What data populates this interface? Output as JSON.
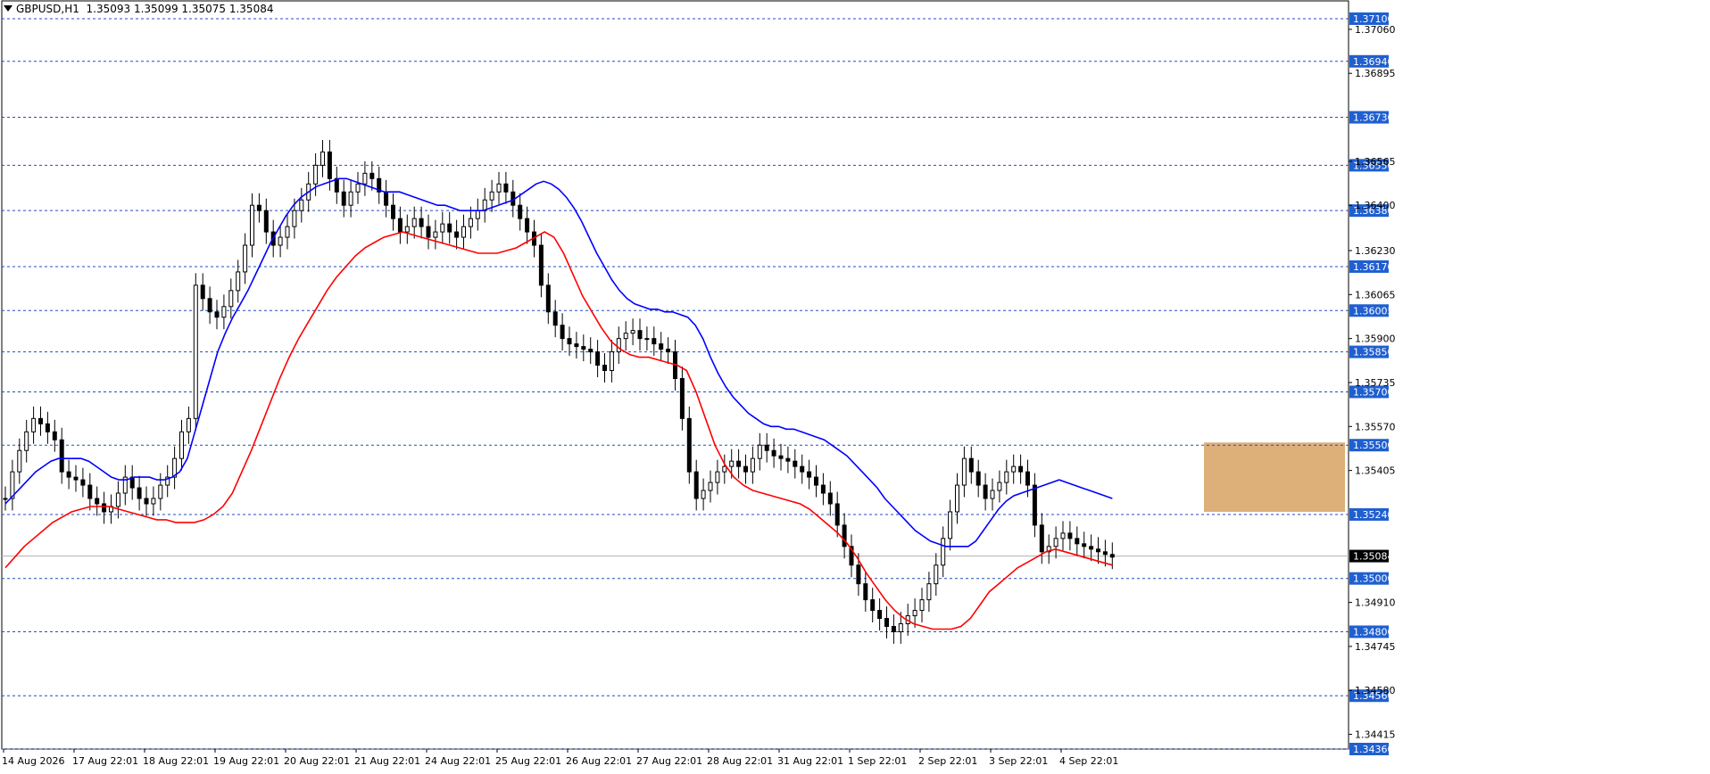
{
  "header": {
    "symbol": "GBPUSD,H1",
    "ohlc": "1.35093 1.35099 1.35075 1.35084"
  },
  "colors": {
    "ma_fast": "#0000ff",
    "ma_slow": "#ff0000",
    "level_line": "#1f4fbf",
    "level_label_bg": "#1f5fd0",
    "price_label_bg": "#000000",
    "zone": "#d9a66a",
    "candle": "#000000"
  },
  "chart_data": {
    "type": "candlestick",
    "ylim": [
      1.3436,
      1.3715
    ],
    "y_ticks": [
      "1.37060",
      "1.36895",
      "1.36565",
      "1.36400",
      "1.36230",
      "1.36065",
      "1.35900",
      "1.35735",
      "1.35570",
      "1.35405",
      "1.34910",
      "1.34745",
      "1.34580",
      "1.34415"
    ],
    "x_ticks": [
      "14 Aug 2026",
      "17 Aug 22:01",
      "18 Aug 22:01",
      "19 Aug 22:01",
      "20 Aug 22:01",
      "21 Aug 22:01",
      "24 Aug 22:01",
      "25 Aug 22:01",
      "26 Aug 22:01",
      "27 Aug 22:01",
      "28 Aug 22:01",
      "31 Aug 22:01",
      "1 Sep 22:01",
      "2 Sep 22:01",
      "3 Sep 22:01",
      "4 Sep 22:01"
    ],
    "levels": [
      "1.37100",
      "1.36940",
      "1.36730",
      "1.36550",
      "1.36380",
      "1.36170",
      "1.36005",
      "1.35850",
      "1.35700",
      "1.35500",
      "1.35240",
      "1.35000",
      "1.34800",
      "1.34560",
      "1.34360"
    ],
    "current_price": "1.35084",
    "zone": {
      "x_start": 170,
      "x_end": 190,
      "price_low": 1.3525,
      "price_high": 1.3551
    },
    "close": [
      1.353,
      1.354,
      1.3548,
      1.3555,
      1.356,
      1.3558,
      1.3555,
      1.3552,
      1.354,
      1.3538,
      1.3537,
      1.3535,
      1.353,
      1.3528,
      1.3525,
      1.3527,
      1.3532,
      1.3538,
      1.3534,
      1.353,
      1.3528,
      1.353,
      1.3535,
      1.3538,
      1.3545,
      1.3555,
      1.356,
      1.361,
      1.3605,
      1.36,
      1.3598,
      1.3602,
      1.3608,
      1.3615,
      1.3625,
      1.364,
      1.3638,
      1.363,
      1.3625,
      1.3628,
      1.3632,
      1.3638,
      1.3642,
      1.3648,
      1.3655,
      1.366,
      1.365,
      1.3645,
      1.364,
      1.3645,
      1.3648,
      1.3652,
      1.365,
      1.3645,
      1.364,
      1.3635,
      1.363,
      1.3632,
      1.3635,
      1.3632,
      1.3628,
      1.363,
      1.3633,
      1.363,
      1.3628,
      1.3632,
      1.3635,
      1.3638,
      1.3642,
      1.3645,
      1.3648,
      1.3645,
      1.364,
      1.3635,
      1.363,
      1.3625,
      1.361,
      1.36,
      1.3595,
      1.359,
      1.3588,
      1.3587,
      1.3586,
      1.3585,
      1.358,
      1.3578,
      1.3585,
      1.359,
      1.3592,
      1.3593,
      1.359,
      1.359,
      1.3588,
      1.3586,
      1.3585,
      1.3575,
      1.356,
      1.354,
      1.353,
      1.3533,
      1.3536,
      1.354,
      1.3542,
      1.3544,
      1.3542,
      1.354,
      1.3545,
      1.355,
      1.3548,
      1.3546,
      1.3545,
      1.3544,
      1.3542,
      1.354,
      1.3538,
      1.3535,
      1.3532,
      1.3528,
      1.352,
      1.3512,
      1.3505,
      1.3498,
      1.3492,
      1.3488,
      1.3485,
      1.3482,
      1.348,
      1.3483,
      1.3486,
      1.3488,
      1.3492,
      1.3498,
      1.3505,
      1.3515,
      1.3525,
      1.3535,
      1.3545,
      1.354,
      1.3535,
      1.353,
      1.3533,
      1.3536,
      1.354,
      1.3542,
      1.354,
      1.3535,
      1.352,
      1.351,
      1.3512,
      1.3515,
      1.3517,
      1.3515,
      1.3513,
      1.3512,
      1.3511,
      1.351,
      1.3509,
      1.3508
    ],
    "ma_fast": [
      1.3528,
      1.3531,
      1.3534,
      1.3537,
      1.354,
      1.3542,
      1.3544,
      1.3545,
      1.3545,
      1.3545,
      1.3545,
      1.3544,
      1.3542,
      1.354,
      1.3538,
      1.3537,
      1.3537,
      1.3538,
      1.3538,
      1.3538,
      1.3537,
      1.3537,
      1.3538,
      1.354,
      1.3545,
      1.3555,
      1.3565,
      1.3575,
      1.3585,
      1.3592,
      1.3598,
      1.3603,
      1.3608,
      1.3614,
      1.362,
      1.3626,
      1.3631,
      1.3636,
      1.364,
      1.3643,
      1.3645,
      1.3647,
      1.3648,
      1.3649,
      1.365,
      1.365,
      1.3649,
      1.3648,
      1.3647,
      1.3646,
      1.3645,
      1.3645,
      1.3645,
      1.3644,
      1.3643,
      1.3642,
      1.3641,
      1.364,
      1.364,
      1.3639,
      1.3638,
      1.3638,
      1.3638,
      1.3638,
      1.3639,
      1.364,
      1.3641,
      1.3642,
      1.3644,
      1.3646,
      1.3648,
      1.3649,
      1.3648,
      1.3646,
      1.3643,
      1.3639,
      1.3634,
      1.3628,
      1.3622,
      1.3617,
      1.3612,
      1.3608,
      1.3605,
      1.3603,
      1.3602,
      1.3601,
      1.3601,
      1.36,
      1.36,
      1.3599,
      1.3598,
      1.3595,
      1.359,
      1.3583,
      1.3577,
      1.3572,
      1.3568,
      1.3565,
      1.3562,
      1.356,
      1.3558,
      1.3557,
      1.3557,
      1.3556,
      1.3556,
      1.3555,
      1.3554,
      1.3553,
      1.3552,
      1.355,
      1.3548,
      1.3546,
      1.3543,
      1.354,
      1.3537,
      1.3534,
      1.353,
      1.3527,
      1.3524,
      1.3521,
      1.3518,
      1.3516,
      1.3514,
      1.3513,
      1.3512,
      1.3512,
      1.3512,
      1.3512,
      1.3514,
      1.3518,
      1.3522,
      1.3526,
      1.3529,
      1.3531,
      1.3532,
      1.3533,
      1.3534,
      1.3535,
      1.3536,
      1.3537,
      1.3536,
      1.3535,
      1.3534,
      1.3533,
      1.3532,
      1.3531,
      1.353
    ],
    "ma_slow": [
      1.3504,
      1.3508,
      1.3512,
      1.3515,
      1.3518,
      1.3521,
      1.3523,
      1.3525,
      1.3526,
      1.3527,
      1.3527,
      1.3527,
      1.3526,
      1.3525,
      1.3524,
      1.3523,
      1.3522,
      1.3522,
      1.3521,
      1.3521,
      1.3521,
      1.3522,
      1.3524,
      1.3527,
      1.3532,
      1.354,
      1.3548,
      1.3557,
      1.3566,
      1.3575,
      1.3583,
      1.359,
      1.3596,
      1.3602,
      1.3608,
      1.3613,
      1.3617,
      1.3621,
      1.3624,
      1.3626,
      1.3628,
      1.3629,
      1.363,
      1.3629,
      1.3628,
      1.3627,
      1.3626,
      1.3625,
      1.3624,
      1.3623,
      1.3622,
      1.3622,
      1.3622,
      1.3623,
      1.3624,
      1.3626,
      1.3628,
      1.363,
      1.3628,
      1.3622,
      1.3614,
      1.3606,
      1.36,
      1.3594,
      1.3589,
      1.3586,
      1.3584,
      1.3583,
      1.3583,
      1.3582,
      1.3581,
      1.358,
      1.3578,
      1.357,
      1.356,
      1.355,
      1.3543,
      1.3538,
      1.3535,
      1.3533,
      1.3532,
      1.3531,
      1.353,
      1.3529,
      1.3528,
      1.3526,
      1.3523,
      1.352,
      1.3517,
      1.3513,
      1.3508,
      1.3502,
      1.3497,
      1.3492,
      1.3488,
      1.3485,
      1.3483,
      1.3482,
      1.3481,
      1.3481,
      1.3481,
      1.3482,
      1.3485,
      1.349,
      1.3495,
      1.3498,
      1.3501,
      1.3504,
      1.3506,
      1.3508,
      1.351,
      1.3511,
      1.351,
      1.3509,
      1.3508,
      1.3507,
      1.3506,
      1.3505
    ]
  }
}
